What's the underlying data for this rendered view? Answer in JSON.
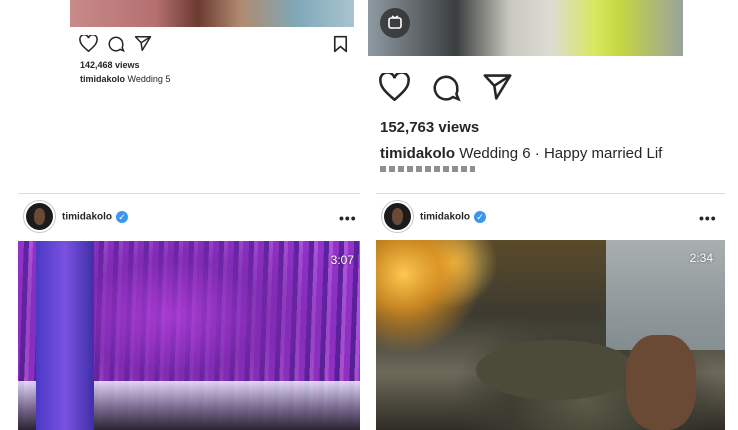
{
  "posts": [
    {
      "views": "142,468 views",
      "username": "timidakolo",
      "caption": "Wedding 5",
      "icons": [
        "heart-icon",
        "comment-icon",
        "share-icon",
        "bookmark-icon"
      ]
    },
    {
      "views": "152,763 views",
      "username": "timidakolo",
      "caption": "Wedding 6 · Happy married Lif",
      "icons": [
        "heart-icon",
        "comment-icon",
        "share-icon",
        "igtv-icon"
      ]
    },
    {
      "username": "timidakolo",
      "duration": "3:07",
      "more": "•••"
    },
    {
      "username": "timidakolo",
      "duration": "2:34",
      "more": "•••"
    }
  ],
  "colors": {
    "verified": "#3897f0",
    "divider": "#dcdcdc",
    "text": "#262626"
  }
}
